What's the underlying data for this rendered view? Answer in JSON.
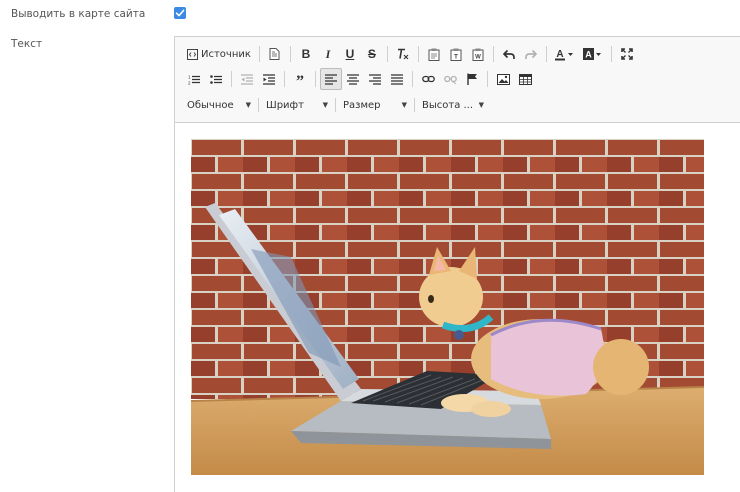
{
  "form": {
    "sitemap_label": "Выводить в карте сайта",
    "sitemap_checked": true,
    "text_label": "Текст"
  },
  "toolbar": {
    "source_label": "Источник",
    "combos": {
      "format": "Обычное",
      "font": "Шрифт",
      "size": "Размер",
      "line_height": "Высота ..."
    }
  },
  "content": {
    "image_alt": "cat with laptop photo"
  },
  "colors": {
    "checkbox": "#3d8ae5",
    "toolbar_bg": "#f8f8f8",
    "border": "#d1d1d1"
  }
}
